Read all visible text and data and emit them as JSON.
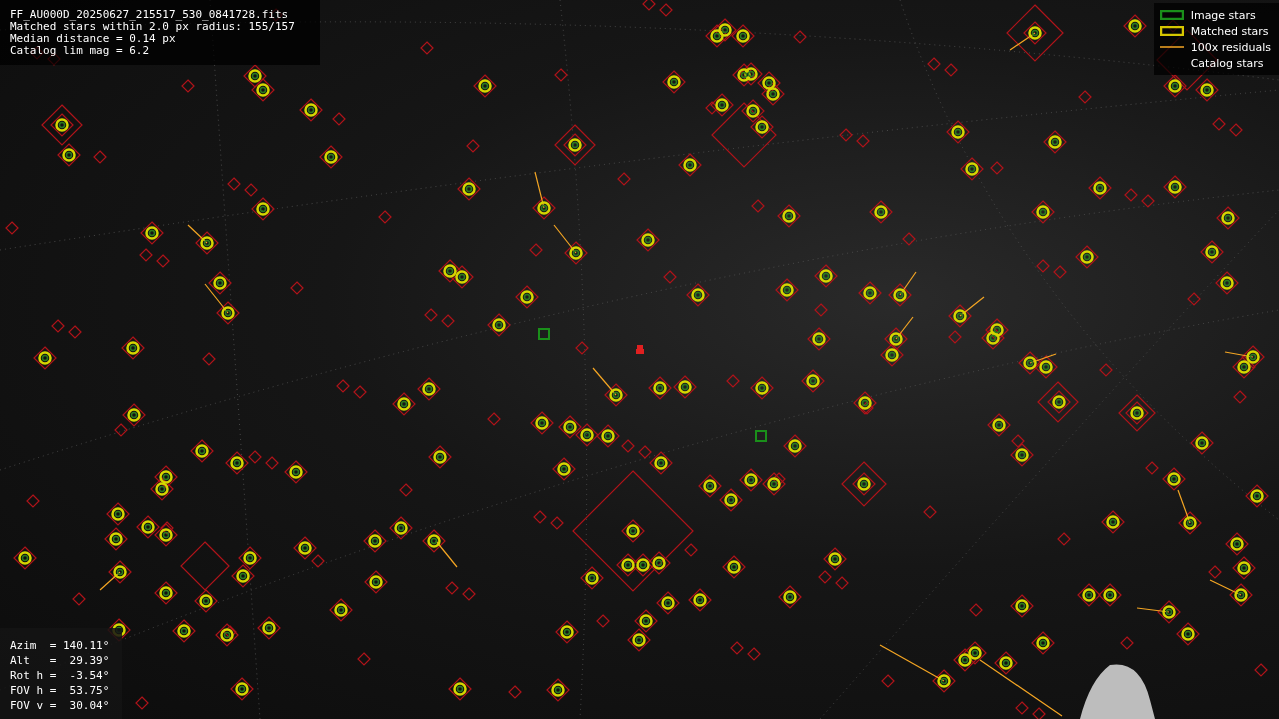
{
  "file_info": {
    "lines": [
      "FF_AU000D_20250627_215517_530_0841728.fits",
      "Matched stars within 2.0 px radius: 155/157",
      "Median distance = 0.14 px",
      "Catalog lim mag = 6.2"
    ]
  },
  "legend": [
    {
      "kind": "image",
      "label": "Image stars"
    },
    {
      "kind": "matched",
      "label": "Matched stars"
    },
    {
      "kind": "residual",
      "label": "100x residuals"
    },
    {
      "kind": "catalog",
      "label": "Catalog stars"
    }
  ],
  "pointing": {
    "lines": [
      "Azim  = 140.11°",
      "Alt   =  29.39°",
      "Rot h =  -3.54°",
      "FOV h =  53.75°",
      "FOV v =  30.04°"
    ]
  }
}
